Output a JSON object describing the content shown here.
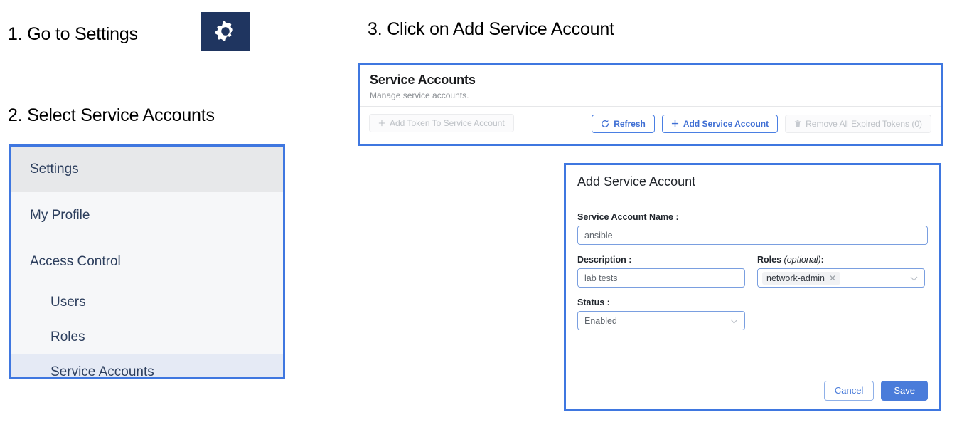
{
  "steps": {
    "step1": "1. Go to Settings",
    "step2": "2. Select Service Accounts",
    "step3": "3. Click on Add Service Account"
  },
  "gear_tile": {
    "icon": "gear-icon",
    "background": "#1f3560",
    "icon_color": "#ffffff"
  },
  "sidebar": {
    "border_color": "#3f77e0",
    "selected_background": "#e5eaf5",
    "items": [
      {
        "label": "Settings",
        "level": "header",
        "selected": false
      },
      {
        "label": "My Profile",
        "level": "top",
        "selected": false
      },
      {
        "label": "Access Control",
        "level": "top",
        "selected": false
      },
      {
        "label": "Users",
        "level": "child",
        "selected": false
      },
      {
        "label": "Roles",
        "level": "child",
        "selected": false
      },
      {
        "label": "Service Accounts",
        "level": "child",
        "selected": true
      }
    ]
  },
  "service_accounts_card": {
    "title": "Service Accounts",
    "subtitle": "Manage service accounts.",
    "border_color": "#3f77e0",
    "toolbar": {
      "add_token": {
        "label": "Add Token To Service Account",
        "icon": "plus-icon",
        "disabled": true
      },
      "refresh": {
        "label": "Refresh",
        "icon": "refresh-icon",
        "disabled": false
      },
      "add_service_account": {
        "label": "Add Service Account",
        "icon": "plus-icon",
        "disabled": false
      },
      "remove_expired": {
        "label": "Remove All Expired Tokens (0)",
        "icon": "trash-icon",
        "disabled": true
      }
    }
  },
  "dialog": {
    "title": "Add Service Account",
    "border_color": "#3f77e0",
    "fields": {
      "name": {
        "label": "Service Account Name :",
        "value": "ansible"
      },
      "description": {
        "label": "Description :",
        "value": "lab tests"
      },
      "roles": {
        "label": "Roles",
        "label_optional": "(optional)",
        "label_suffix": ":",
        "chip": "network-admin",
        "chip_remove_icon": "close-icon",
        "dropdown_icon": "chevron-down-icon"
      },
      "status": {
        "label": "Status :",
        "value": "Enabled",
        "dropdown_icon": "chevron-down-icon"
      }
    },
    "buttons": {
      "cancel": "Cancel",
      "save": "Save"
    },
    "accent_color": "#4a7cda"
  }
}
